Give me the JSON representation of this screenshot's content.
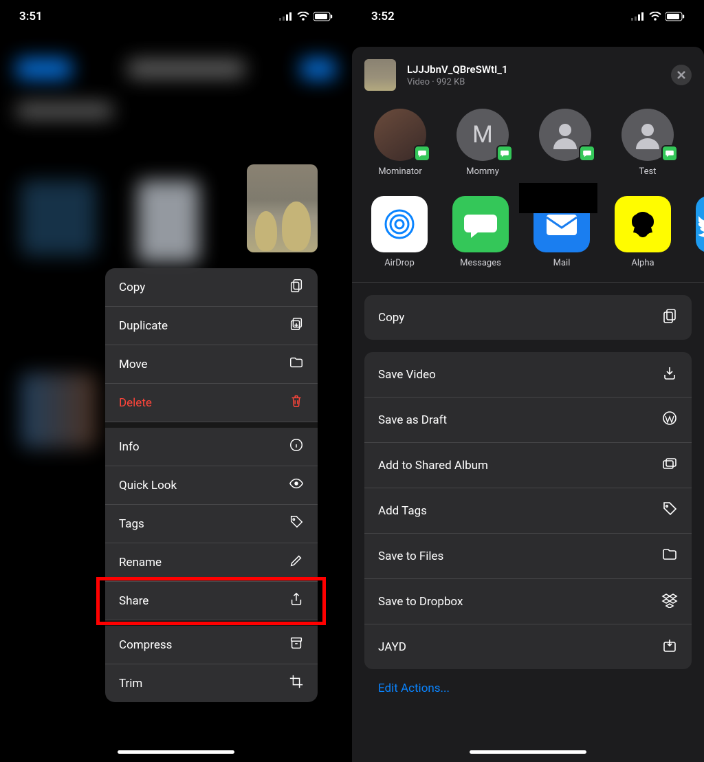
{
  "left": {
    "status_time": "3:51",
    "context_menu": [
      {
        "label": "Copy",
        "icon": "copy-icon",
        "style": ""
      },
      {
        "label": "Duplicate",
        "icon": "duplicate-icon",
        "style": ""
      },
      {
        "label": "Move",
        "icon": "folder-icon",
        "style": ""
      },
      {
        "label": "Delete",
        "icon": "trash-icon",
        "style": "destructive"
      },
      {
        "label": "Info",
        "icon": "info-icon",
        "style": "spacer-above"
      },
      {
        "label": "Quick Look",
        "icon": "eye-icon",
        "style": ""
      },
      {
        "label": "Tags",
        "icon": "tag-icon",
        "style": ""
      },
      {
        "label": "Rename",
        "icon": "pencil-icon",
        "style": ""
      },
      {
        "label": "Share",
        "icon": "share-icon",
        "style": ""
      },
      {
        "label": "Compress",
        "icon": "archive-icon",
        "style": "spacer-above"
      },
      {
        "label": "Trim",
        "icon": "crop-icon",
        "style": ""
      }
    ]
  },
  "right": {
    "status_time": "3:52",
    "file": {
      "name": "LJJJbnV_QBreSWtI_1",
      "meta": "Video · 992 KB"
    },
    "contacts": [
      {
        "name": "Mominator",
        "avatar": "photo"
      },
      {
        "name": "Mommy",
        "avatar": "M"
      },
      {
        "name": "",
        "avatar": "person"
      },
      {
        "name": "Test",
        "avatar": "person"
      }
    ],
    "apps": [
      {
        "name": "AirDrop",
        "kind": "airdrop"
      },
      {
        "name": "Messages",
        "kind": "messages"
      },
      {
        "name": "Mail",
        "kind": "mail"
      },
      {
        "name": "Alpha",
        "kind": "alpha"
      },
      {
        "name": "T",
        "kind": "twitter"
      }
    ],
    "actions_group1": [
      {
        "label": "Copy",
        "icon": "copy-icon"
      }
    ],
    "actions_group2": [
      {
        "label": "Save Video",
        "icon": "download-icon"
      },
      {
        "label": "Save as Draft",
        "icon": "wordpress-icon"
      },
      {
        "label": "Add to Shared Album",
        "icon": "shared-album-icon"
      },
      {
        "label": "Add Tags",
        "icon": "tag-icon"
      },
      {
        "label": "Save to Files",
        "icon": "folder-icon"
      },
      {
        "label": "Save to Dropbox",
        "icon": "dropbox-icon"
      },
      {
        "label": "JAYD",
        "icon": "download-box-icon"
      }
    ],
    "edit_actions": "Edit Actions..."
  }
}
